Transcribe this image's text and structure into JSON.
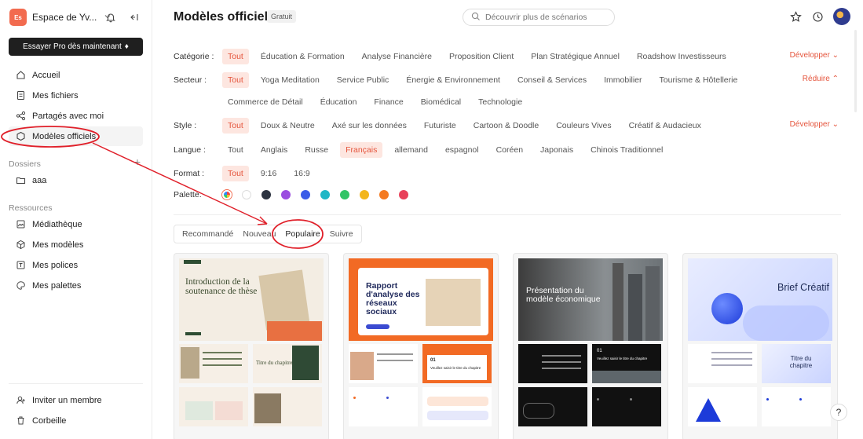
{
  "workspace": {
    "initials": "Es",
    "name": "Espace de Yv..."
  },
  "sidebar": {
    "pro_button": "Essayer Pro dès maintenant",
    "nav": [
      {
        "label": "Accueil",
        "icon": "home-icon"
      },
      {
        "label": "Mes fichiers",
        "icon": "file-icon"
      },
      {
        "label": "Partagés avec moi",
        "icon": "share-icon"
      },
      {
        "label": "Modèles officiels",
        "icon": "templates-icon"
      }
    ],
    "folders_label": "Dossiers",
    "folders": [
      {
        "label": "aaa",
        "icon": "folder-icon"
      }
    ],
    "resources_label": "Ressources",
    "resources": [
      {
        "label": "Médiathèque",
        "icon": "media-icon"
      },
      {
        "label": "Mes modèles",
        "icon": "cube-icon"
      },
      {
        "label": "Mes polices",
        "icon": "font-icon"
      },
      {
        "label": "Mes palettes",
        "icon": "palette-icon"
      }
    ],
    "bottom": [
      {
        "label": "Inviter un membre",
        "icon": "invite-icon"
      },
      {
        "label": "Corbeille",
        "icon": "trash-icon"
      }
    ]
  },
  "header": {
    "title": "Modèles officiels",
    "badge": "Gratuit",
    "search_placeholder": "Découvrir plus de scénarios"
  },
  "filters": {
    "category": {
      "label": "Catégorie :",
      "options": [
        "Tout",
        "Éducation & Formation",
        "Analyse Financière",
        "Proposition Client",
        "Plan Stratégique Annuel",
        "Roadshow Investisseurs"
      ],
      "selected": "Tout",
      "toggle": "Développer"
    },
    "sector": {
      "label": "Secteur :",
      "options": [
        "Tout",
        "Yoga Meditation",
        "Service Public",
        "Énergie & Environnement",
        "Conseil & Services",
        "Immobilier",
        "Tourisme & Hôtellerie"
      ],
      "options2": [
        "Commerce de Détail",
        "Éducation",
        "Finance",
        "Biomédical",
        "Technologie"
      ],
      "selected": "Tout",
      "toggle": "Réduire"
    },
    "style": {
      "label": "Style :",
      "options": [
        "Tout",
        "Doux & Neutre",
        "Axé sur les données",
        "Futuriste",
        "Cartoon & Doodle",
        "Couleurs Vives",
        "Créatif & Audacieux"
      ],
      "selected": "Tout",
      "toggle": "Développer"
    },
    "language": {
      "label": "Langue :",
      "options": [
        "Tout",
        "Anglais",
        "Russe",
        "Français",
        "allemand",
        "espagnol",
        "Coréen",
        "Japonais",
        "Chinois Traditionnel"
      ],
      "selected": "Français"
    },
    "format": {
      "label": "Format :",
      "options": [
        "Tout",
        "9:16",
        "16:9"
      ],
      "selected": "Tout"
    },
    "palette": {
      "label": "Palette:",
      "colors": [
        "multi",
        "#ffffff",
        "#2c3340",
        "#9b4de0",
        "#3b5de8",
        "#1fb7c6",
        "#32c466",
        "#f3b61d",
        "#f47a21",
        "#e8415a"
      ]
    }
  },
  "tabs": {
    "items": [
      "Recommandé",
      "Nouveau",
      "Populaire",
      "Suivre"
    ],
    "selected": "Populaire"
  },
  "cards": [
    {
      "title": "Introduction de la soutenance de thèse",
      "tile_title": "Titre du chapitre"
    },
    {
      "title": "Rapport d'analyse des réseaux sociaux",
      "tile_title": "Veuillez saisir le titre du chapitre",
      "tile_number": "01"
    },
    {
      "title": "Présentation du modèle économique",
      "tile_title": "Veuillez saisir le titre du chapitre",
      "tile_number": "01"
    },
    {
      "title": "Brief Créatif",
      "tile_title": "Titre du chapitre"
    }
  ],
  "help_label": "?"
}
